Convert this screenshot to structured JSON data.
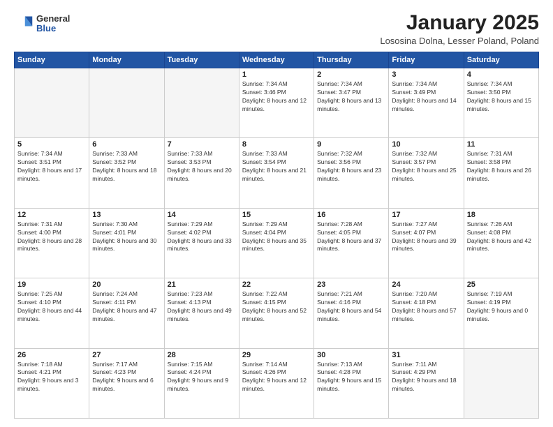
{
  "header": {
    "logo": {
      "general": "General",
      "blue": "Blue"
    },
    "title": "January 2025",
    "location": "Lososina Dolna, Lesser Poland, Poland"
  },
  "weekdays": [
    "Sunday",
    "Monday",
    "Tuesday",
    "Wednesday",
    "Thursday",
    "Friday",
    "Saturday"
  ],
  "weeks": [
    [
      {
        "day": "",
        "empty": true
      },
      {
        "day": "",
        "empty": true
      },
      {
        "day": "",
        "empty": true
      },
      {
        "day": "1",
        "sunrise": "7:34 AM",
        "sunset": "3:46 PM",
        "daylight": "8 hours and 12 minutes."
      },
      {
        "day": "2",
        "sunrise": "7:34 AM",
        "sunset": "3:47 PM",
        "daylight": "8 hours and 13 minutes."
      },
      {
        "day": "3",
        "sunrise": "7:34 AM",
        "sunset": "3:49 PM",
        "daylight": "8 hours and 14 minutes."
      },
      {
        "day": "4",
        "sunrise": "7:34 AM",
        "sunset": "3:50 PM",
        "daylight": "8 hours and 15 minutes."
      }
    ],
    [
      {
        "day": "5",
        "sunrise": "7:34 AM",
        "sunset": "3:51 PM",
        "daylight": "8 hours and 17 minutes."
      },
      {
        "day": "6",
        "sunrise": "7:33 AM",
        "sunset": "3:52 PM",
        "daylight": "8 hours and 18 minutes."
      },
      {
        "day": "7",
        "sunrise": "7:33 AM",
        "sunset": "3:53 PM",
        "daylight": "8 hours and 20 minutes."
      },
      {
        "day": "8",
        "sunrise": "7:33 AM",
        "sunset": "3:54 PM",
        "daylight": "8 hours and 21 minutes."
      },
      {
        "day": "9",
        "sunrise": "7:32 AM",
        "sunset": "3:56 PM",
        "daylight": "8 hours and 23 minutes."
      },
      {
        "day": "10",
        "sunrise": "7:32 AM",
        "sunset": "3:57 PM",
        "daylight": "8 hours and 25 minutes."
      },
      {
        "day": "11",
        "sunrise": "7:31 AM",
        "sunset": "3:58 PM",
        "daylight": "8 hours and 26 minutes."
      }
    ],
    [
      {
        "day": "12",
        "sunrise": "7:31 AM",
        "sunset": "4:00 PM",
        "daylight": "8 hours and 28 minutes."
      },
      {
        "day": "13",
        "sunrise": "7:30 AM",
        "sunset": "4:01 PM",
        "daylight": "8 hours and 30 minutes."
      },
      {
        "day": "14",
        "sunrise": "7:29 AM",
        "sunset": "4:02 PM",
        "daylight": "8 hours and 33 minutes."
      },
      {
        "day": "15",
        "sunrise": "7:29 AM",
        "sunset": "4:04 PM",
        "daylight": "8 hours and 35 minutes."
      },
      {
        "day": "16",
        "sunrise": "7:28 AM",
        "sunset": "4:05 PM",
        "daylight": "8 hours and 37 minutes."
      },
      {
        "day": "17",
        "sunrise": "7:27 AM",
        "sunset": "4:07 PM",
        "daylight": "8 hours and 39 minutes."
      },
      {
        "day": "18",
        "sunrise": "7:26 AM",
        "sunset": "4:08 PM",
        "daylight": "8 hours and 42 minutes."
      }
    ],
    [
      {
        "day": "19",
        "sunrise": "7:25 AM",
        "sunset": "4:10 PM",
        "daylight": "8 hours and 44 minutes."
      },
      {
        "day": "20",
        "sunrise": "7:24 AM",
        "sunset": "4:11 PM",
        "daylight": "8 hours and 47 minutes."
      },
      {
        "day": "21",
        "sunrise": "7:23 AM",
        "sunset": "4:13 PM",
        "daylight": "8 hours and 49 minutes."
      },
      {
        "day": "22",
        "sunrise": "7:22 AM",
        "sunset": "4:15 PM",
        "daylight": "8 hours and 52 minutes."
      },
      {
        "day": "23",
        "sunrise": "7:21 AM",
        "sunset": "4:16 PM",
        "daylight": "8 hours and 54 minutes."
      },
      {
        "day": "24",
        "sunrise": "7:20 AM",
        "sunset": "4:18 PM",
        "daylight": "8 hours and 57 minutes."
      },
      {
        "day": "25",
        "sunrise": "7:19 AM",
        "sunset": "4:19 PM",
        "daylight": "9 hours and 0 minutes."
      }
    ],
    [
      {
        "day": "26",
        "sunrise": "7:18 AM",
        "sunset": "4:21 PM",
        "daylight": "9 hours and 3 minutes."
      },
      {
        "day": "27",
        "sunrise": "7:17 AM",
        "sunset": "4:23 PM",
        "daylight": "9 hours and 6 minutes."
      },
      {
        "day": "28",
        "sunrise": "7:15 AM",
        "sunset": "4:24 PM",
        "daylight": "9 hours and 9 minutes."
      },
      {
        "day": "29",
        "sunrise": "7:14 AM",
        "sunset": "4:26 PM",
        "daylight": "9 hours and 12 minutes."
      },
      {
        "day": "30",
        "sunrise": "7:13 AM",
        "sunset": "4:28 PM",
        "daylight": "9 hours and 15 minutes."
      },
      {
        "day": "31",
        "sunrise": "7:11 AM",
        "sunset": "4:29 PM",
        "daylight": "9 hours and 18 minutes."
      },
      {
        "day": "",
        "empty": true
      }
    ]
  ]
}
